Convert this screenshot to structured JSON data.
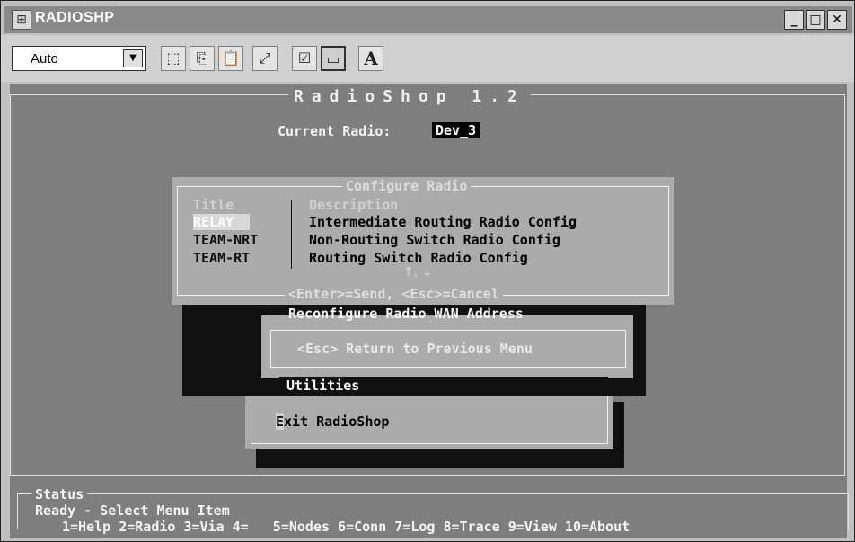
{
  "window": {
    "title": "RADIOSHP",
    "controls": {
      "minimize": "_",
      "maximize": "□",
      "close": "✕"
    }
  },
  "toolbar": {
    "font_value": "Auto",
    "buttons": [
      "mark",
      "copy",
      "paste",
      "fullscreen",
      "properties",
      "background",
      "font"
    ]
  },
  "terminal": {
    "app_title": "RadioShop 1.2",
    "current_radio_label": "Current Radio:",
    "current_radio_value": "Dev_3"
  },
  "main_menu": {
    "items": [
      {
        "label": "Reconfigure Radio WAN Address",
        "highlighted": true
      },
      {
        "label": "<Esc> Return to Previous Menu",
        "highlighted": false
      },
      {
        "label": "Utilities",
        "highlighted": true
      },
      {
        "label": "Exit RadioShop",
        "highlighted": false,
        "hotkey": "E",
        "rest": "xit RadioShop"
      }
    ]
  },
  "configure_dialog": {
    "title": "Configure Radio",
    "col_title": "Title",
    "col_desc": "Description",
    "rows": [
      {
        "title": "RELAY",
        "description": "Intermediate Routing Radio Config",
        "selected": true
      },
      {
        "title": "TEAM-NRT",
        "description": "Non-Routing Switch Radio Config",
        "selected": false
      },
      {
        "title": "TEAM-RT",
        "description": "Routing Switch Radio Config",
        "selected": false
      }
    ],
    "scroll_arrows": "↑, ↓",
    "hint": "<Enter>=Send, <Esc>=Cancel"
  },
  "status": {
    "label": "Status",
    "text": "Ready - Select Menu Item",
    "fkeys": "1=Help 2=Radio 3=Via 4=   5=Nodes 6=Conn 7=Log 8=Trace 9=View 10=About"
  }
}
